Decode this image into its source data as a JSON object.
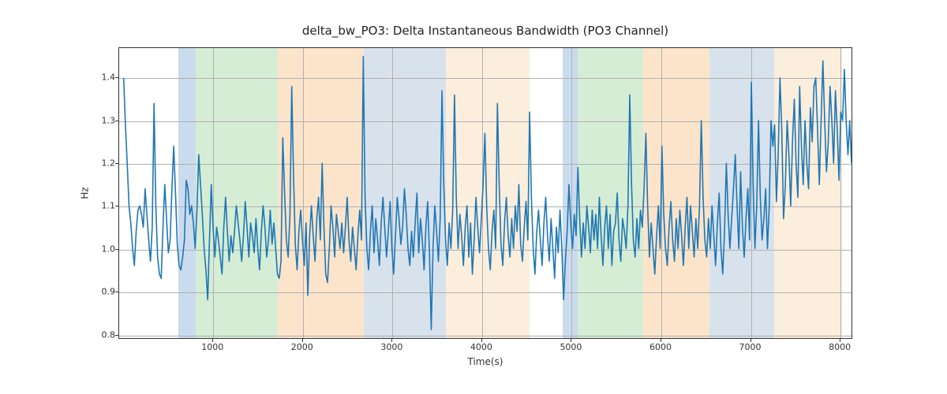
{
  "chart_data": {
    "type": "line",
    "title": "delta_bw_PO3: Delta Instantaneous Bandwidth (PO3 Channel)",
    "xlabel": "Time(s)",
    "ylabel": "Hz",
    "xlim": [
      -50,
      8140
    ],
    "ylim": [
      0.79,
      1.47
    ],
    "xticks": [
      1000,
      2000,
      3000,
      4000,
      5000,
      6000,
      7000,
      8000
    ],
    "yticks": [
      0.8,
      0.9,
      1.0,
      1.1,
      1.2,
      1.3,
      1.4
    ],
    "bands": [
      {
        "x0": 610,
        "x1": 800,
        "color": "#6699cc"
      },
      {
        "x0": 800,
        "x1": 1720,
        "color": "#88cc88"
      },
      {
        "x0": 1720,
        "x1": 2680,
        "color": "#f5b26b"
      },
      {
        "x0": 2680,
        "x1": 3600,
        "color": "#8faccc"
      },
      {
        "x0": 3600,
        "x1": 4530,
        "color": "#f7cd9c"
      },
      {
        "x0": 4900,
        "x1": 5070,
        "color": "#6699cc"
      },
      {
        "x0": 5070,
        "x1": 5800,
        "color": "#88cc88"
      },
      {
        "x0": 5800,
        "x1": 6540,
        "color": "#f5b26b"
      },
      {
        "x0": 6540,
        "x1": 7260,
        "color": "#8faccc"
      },
      {
        "x0": 7260,
        "x1": 8020,
        "color": "#f7cd9c"
      }
    ],
    "series": [
      {
        "name": "delta_bw_PO3",
        "x_step": 20,
        "x_start": 0,
        "values": [
          1.4,
          1.29,
          1.2,
          1.1,
          1.06,
          1.0,
          0.96,
          1.04,
          1.09,
          1.1,
          1.08,
          1.05,
          1.14,
          1.08,
          1.02,
          0.97,
          1.05,
          1.34,
          1.1,
          0.98,
          0.94,
          0.93,
          1.05,
          1.15,
          1.07,
          0.99,
          1.02,
          1.14,
          1.24,
          1.13,
          1.01,
          0.96,
          0.95,
          0.98,
          1.02,
          1.16,
          1.14,
          1.08,
          1.1,
          1.06,
          1.0,
          1.09,
          1.22,
          1.15,
          1.08,
          1.0,
          0.95,
          0.88,
          1.02,
          1.15,
          1.05,
          0.98,
          1.05,
          1.02,
          0.98,
          0.94,
          1.05,
          1.12,
          1.04,
          0.97,
          1.03,
          0.99,
          1.04,
          1.1,
          1.06,
          1.02,
          0.97,
          1.03,
          1.11,
          1.05,
          0.98,
          1.06,
          1.03,
          0.99,
          1.07,
          1.0,
          0.95,
          1.04,
          1.1,
          1.05,
          0.98,
          1.02,
          1.09,
          1.01,
          1.06,
          1.0,
          0.94,
          0.93,
          0.97,
          1.26,
          1.13,
          1.02,
          0.98,
          1.08,
          1.38,
          1.17,
          1.01,
          0.95,
          1.04,
          1.09,
          1.02,
          0.96,
          1.06,
          0.89,
          1.03,
          1.1,
          1.03,
          0.97,
          1.07,
          1.12,
          1.02,
          1.2,
          1.05,
          0.94,
          0.92,
          1.0,
          1.1,
          1.05,
          0.98,
          1.08,
          1.04,
          1.0,
          1.06,
          0.99,
          1.05,
          1.12,
          1.02,
          0.97,
          1.05,
          1.0,
          0.95,
          1.03,
          1.09,
          1.02,
          1.45,
          1.12,
          1.0,
          0.95,
          1.04,
          1.1,
          0.99,
          1.07,
          1.02,
          0.96,
          1.06,
          1.12,
          1.05,
          0.98,
          1.04,
          1.11,
          1.0,
          0.94,
          1.03,
          1.12,
          1.07,
          1.01,
          1.05,
          1.14,
          1.08,
          1.0,
          0.96,
          1.04,
          0.98,
          1.06,
          1.13,
          0.99,
          1.07,
          1.02,
          0.95,
          1.05,
          1.11,
          0.99,
          0.81,
          1.0,
          1.1,
          1.04,
          0.97,
          1.07,
          1.37,
          1.15,
          1.02,
          0.96,
          1.06,
          1.0,
          1.09,
          1.36,
          1.12,
          1.0,
          1.08,
          1.03,
          0.96,
          1.05,
          1.1,
          0.98,
          1.06,
          0.94,
          1.02,
          1.12,
          1.05,
          0.99,
          1.07,
          1.15,
          1.27,
          1.1,
          1.0,
          0.95,
          1.04,
          1.09,
          1.0,
          1.34,
          1.15,
          1.01,
          0.96,
          1.06,
          1.12,
          1.03,
          0.98,
          1.07,
          1.0,
          1.1,
          1.04,
          1.15,
          1.01,
          0.97,
          1.05,
          1.11,
          1.02,
          1.32,
          1.12,
          1.0,
          0.94,
          1.04,
          1.09,
          1.02,
          0.96,
          1.06,
          1.12,
          1.03,
          0.97,
          1.07,
          1.0,
          0.93,
          1.05,
          0.99,
          1.09,
          1.0,
          0.88,
          0.97,
          1.04,
          1.15,
          1.06,
          1.0,
          1.08,
          1.03,
          1.19,
          1.07,
          0.98,
          1.06,
          1.0,
          1.1,
          1.05,
          0.99,
          1.09,
          1.02,
          1.08,
          1.0,
          1.12,
          1.03,
          0.96,
          1.05,
          1.1,
          1.0,
          1.08,
          0.96,
          1.04,
          1.06,
          1.13,
          1.02,
          0.97,
          1.07,
          1.04,
          1.0,
          1.1,
          1.36,
          1.15,
          1.02,
          0.98,
          1.07,
          1.0,
          1.09,
          1.05,
          1.14,
          1.27,
          1.1,
          0.98,
          1.06,
          1.0,
          0.94,
          1.03,
          1.1,
          1.0,
          1.24,
          1.08,
          1.0,
          0.96,
          1.05,
          1.11,
          1.02,
          0.97,
          1.07,
          1.0,
          1.09,
          1.03,
          0.96,
          1.05,
          1.12,
          1.0,
          1.1,
          1.04,
          0.98,
          1.07,
          1.0,
          1.1,
          1.3,
          1.12,
          1.02,
          0.98,
          1.07,
          1.0,
          1.1,
          1.03,
          0.96,
          1.06,
          1.13,
          1.0,
          0.94,
          1.04,
          1.2,
          1.08,
          1.0,
          1.07,
          1.14,
          1.22,
          1.1,
          1.0,
          1.18,
          1.05,
          0.98,
          1.07,
          1.14,
          1.02,
          1.39,
          1.15,
          1.0,
          1.1,
          1.3,
          1.12,
          1.02,
          1.07,
          1.14,
          1.0,
          1.1,
          1.3,
          1.24,
          1.29,
          1.11,
          1.22,
          1.4,
          1.28,
          1.07,
          1.15,
          1.3,
          1.22,
          1.1,
          1.25,
          1.35,
          1.2,
          1.12,
          1.38,
          1.24,
          1.15,
          1.3,
          1.2,
          1.14,
          1.33,
          1.25,
          1.38,
          1.4,
          1.28,
          1.15,
          1.3,
          1.44,
          1.3,
          1.18,
          1.25,
          1.38,
          1.3,
          1.2,
          1.37,
          1.28,
          1.16,
          1.32,
          1.3,
          1.42,
          1.3,
          1.22,
          1.3,
          1.2
        ]
      }
    ]
  }
}
